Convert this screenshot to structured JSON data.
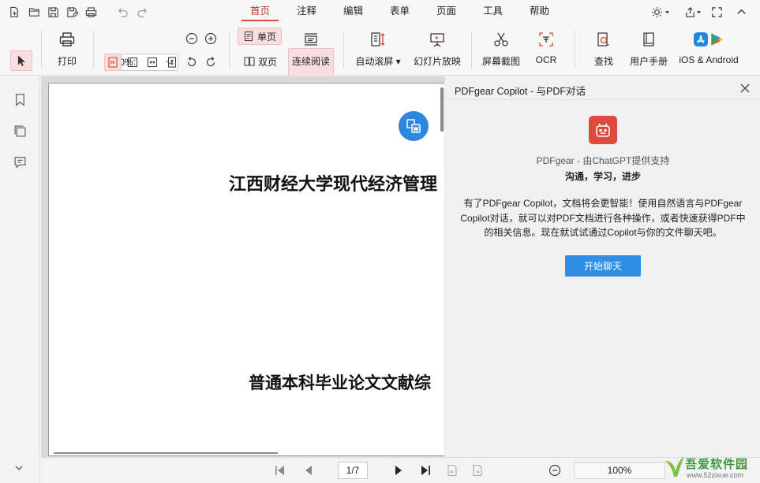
{
  "menu": {
    "tabs": [
      {
        "label": "首页",
        "active": true
      },
      {
        "label": "注释"
      },
      {
        "label": "编辑"
      },
      {
        "label": "表单"
      },
      {
        "label": "页面"
      },
      {
        "label": "工具"
      },
      {
        "label": "帮助"
      }
    ]
  },
  "ribbon": {
    "print_label": "打印",
    "zoom_value": "100%",
    "single_page_label": "单页",
    "double_page_label": "双页",
    "continuous_read_label": "连续阅读",
    "auto_scroll_label": "自动滚屏",
    "slideshow_label": "幻灯片放映",
    "screenshot_label": "屏幕截图",
    "ocr_label": "OCR",
    "find_label": "查找",
    "manual_label": "用户手册",
    "mobile_label": "iOS & Android"
  },
  "document": {
    "title": "江西财经大学现代经济管理",
    "subtitle": "普通本科毕业论文文献综"
  },
  "copilot": {
    "title": "PDFgear Copilot - 与PDF对话",
    "powered_by": "PDFgear - 由ChatGPT提供支持",
    "tagline": "沟通，学习，进步",
    "description": "有了PDFgear Copilot，文档将会更智能！使用自然语言与PDFgear Copilot对话，就可以对PDF文档进行各种操作，或者快速获得PDF中的相关信息。现在就试试通过Copilot与你的文件聊天吧。",
    "start_button": "开始聊天"
  },
  "status": {
    "page_indicator": "1/7",
    "zoom_value": "100%"
  },
  "watermark": {
    "name": "吾爱软件园",
    "url": "www.52zixue.com"
  },
  "colors": {
    "accent": "#d9473b",
    "primary_button": "#2f8ee6",
    "active_bg": "#f8dede"
  }
}
